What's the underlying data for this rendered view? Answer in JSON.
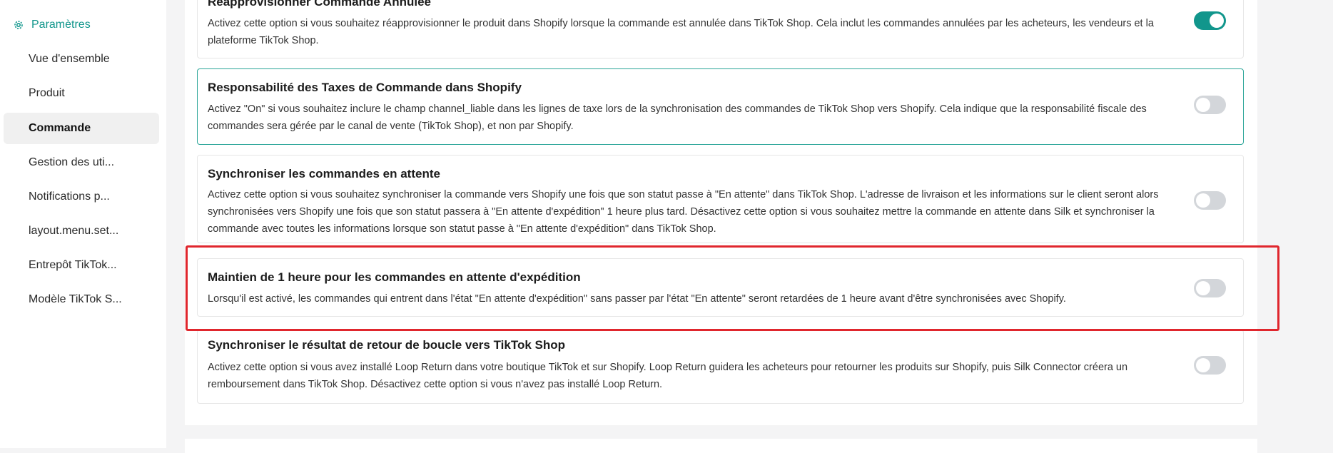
{
  "sidebar": {
    "header_label": "Paramètres",
    "items": [
      {
        "label": "Vue d'ensemble",
        "active": false
      },
      {
        "label": "Produit",
        "active": false
      },
      {
        "label": "Commande",
        "active": true
      },
      {
        "label": "Gestion des uti...",
        "active": false
      },
      {
        "label": "Notifications p...",
        "active": false
      },
      {
        "label": "layout.menu.set...",
        "active": false
      },
      {
        "label": "Entrepôt TikTok...",
        "active": false
      },
      {
        "label": "Modèle TikTok S...",
        "active": false
      }
    ]
  },
  "settings": [
    {
      "title": "Réapprovisionner Commande Annulée",
      "description": "Activez cette option si vous souhaitez réapprovisionner le produit dans Shopify lorsque la commande est annulée dans TikTok Shop. Cela inclut les commandes annulées par les acheteurs, les vendeurs et la plateforme TikTok Shop.",
      "enabled": true
    },
    {
      "title": "Responsabilité des Taxes de Commande dans Shopify",
      "description": "Activez \"On\" si vous souhaitez inclure le champ channel_liable dans les lignes de taxe lors de la synchronisation des commandes de TikTok Shop vers Shopify. Cela indique que la responsabilité fiscale des commandes sera gérée par le canal de vente (TikTok Shop), et non par Shopify.",
      "enabled": false
    },
    {
      "title": "Synchroniser les commandes en attente",
      "description": "Activez cette option si vous souhaitez synchroniser la commande vers Shopify une fois que son statut passe à \"En attente\" dans TikTok Shop. L'adresse de livraison et les informations sur le client seront alors synchronisées vers Shopify une fois que son statut passera à \"En attente d'expédition\" 1 heure plus tard. Désactivez cette option si vous souhaitez mettre la commande en attente dans Silk et synchroniser la commande avec toutes les informations lorsque son statut passe à \"En attente d'expédition\" dans TikTok Shop.",
      "enabled": false
    },
    {
      "title": "Maintien de 1 heure pour les commandes en attente d'expédition",
      "description": "Lorsqu'il est activé, les commandes qui entrent dans l'état \"En attente d'expédition\" sans passer par l'état \"En attente\" seront retardées de 1 heure avant d'être synchronisées avec Shopify.",
      "enabled": false
    },
    {
      "title": "Synchroniser le résultat de retour de boucle vers TikTok Shop",
      "description": "Activez cette option si vous avez installé Loop Return dans votre boutique TikTok et sur Shopify. Loop Return guidera les acheteurs pour retourner les produits sur Shopify, puis Silk Connector créera un remboursement dans TikTok Shop. Désactivez cette option si vous n'avez pas installé Loop Return.",
      "enabled": false
    }
  ],
  "colors": {
    "accent": "#11968c",
    "highlight": "#e0262d"
  }
}
